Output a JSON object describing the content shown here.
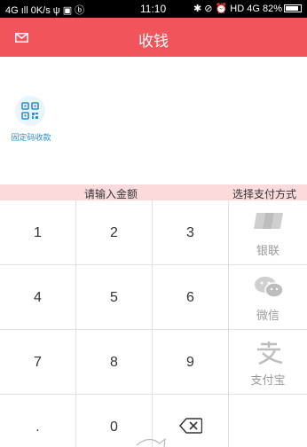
{
  "status_bar": {
    "left": "4G ıll 0K/s ψ ▣ ⓑ",
    "time": "11:10",
    "right": "✱ ⊘ ⏰ HD 4G 82%"
  },
  "header": {
    "title": "收钱"
  },
  "qr_shortcut": {
    "label": "固定码收款"
  },
  "strip": {
    "amount_prompt": "请输入金额",
    "payment_prompt": "选择支付方式"
  },
  "keypad": {
    "keys": [
      "1",
      "2",
      "3",
      "4",
      "5",
      "6",
      "7",
      "8",
      "9",
      ".",
      "0"
    ]
  },
  "payment_methods": [
    {
      "label": "银联",
      "icon": "unionpay-icon"
    },
    {
      "label": "微信",
      "icon": "wechat-icon"
    },
    {
      "label": "支付宝",
      "icon": "alipay-icon"
    }
  ],
  "colors": {
    "accent": "#f2545b",
    "strip": "#fadadb",
    "qr_blue": "#2a8fd0"
  }
}
